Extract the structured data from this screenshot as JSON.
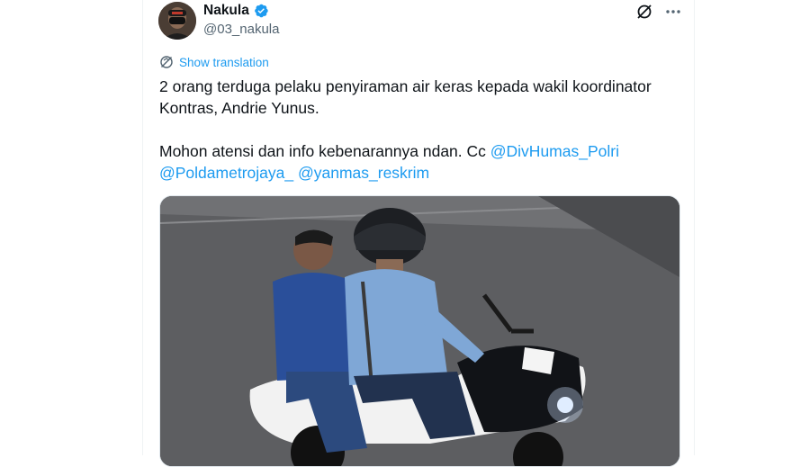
{
  "tweet": {
    "author": {
      "display_name": "Nakula",
      "handle": "@03_nakula",
      "verified": true
    },
    "translate_label": "Show translation",
    "text_line1": "2 orang terduga pelaku penyiraman air keras kepada wakil koordinator Kontras, Andrie Yunus.",
    "text_line2_prefix": "Mohon atensi dan info kebenarannya ndan. Cc ",
    "mentions": [
      "@DivHumas_Polri",
      "@Poldametrojaya_",
      "@yanmas_reskrim"
    ],
    "media_alt": ""
  },
  "colors": {
    "accent": "#1d9bf0",
    "text": "#0f1419",
    "muted": "#536471"
  },
  "icons": [
    "verified-badge-icon",
    "grok-icon",
    "more-icon",
    "translate-icon"
  ]
}
